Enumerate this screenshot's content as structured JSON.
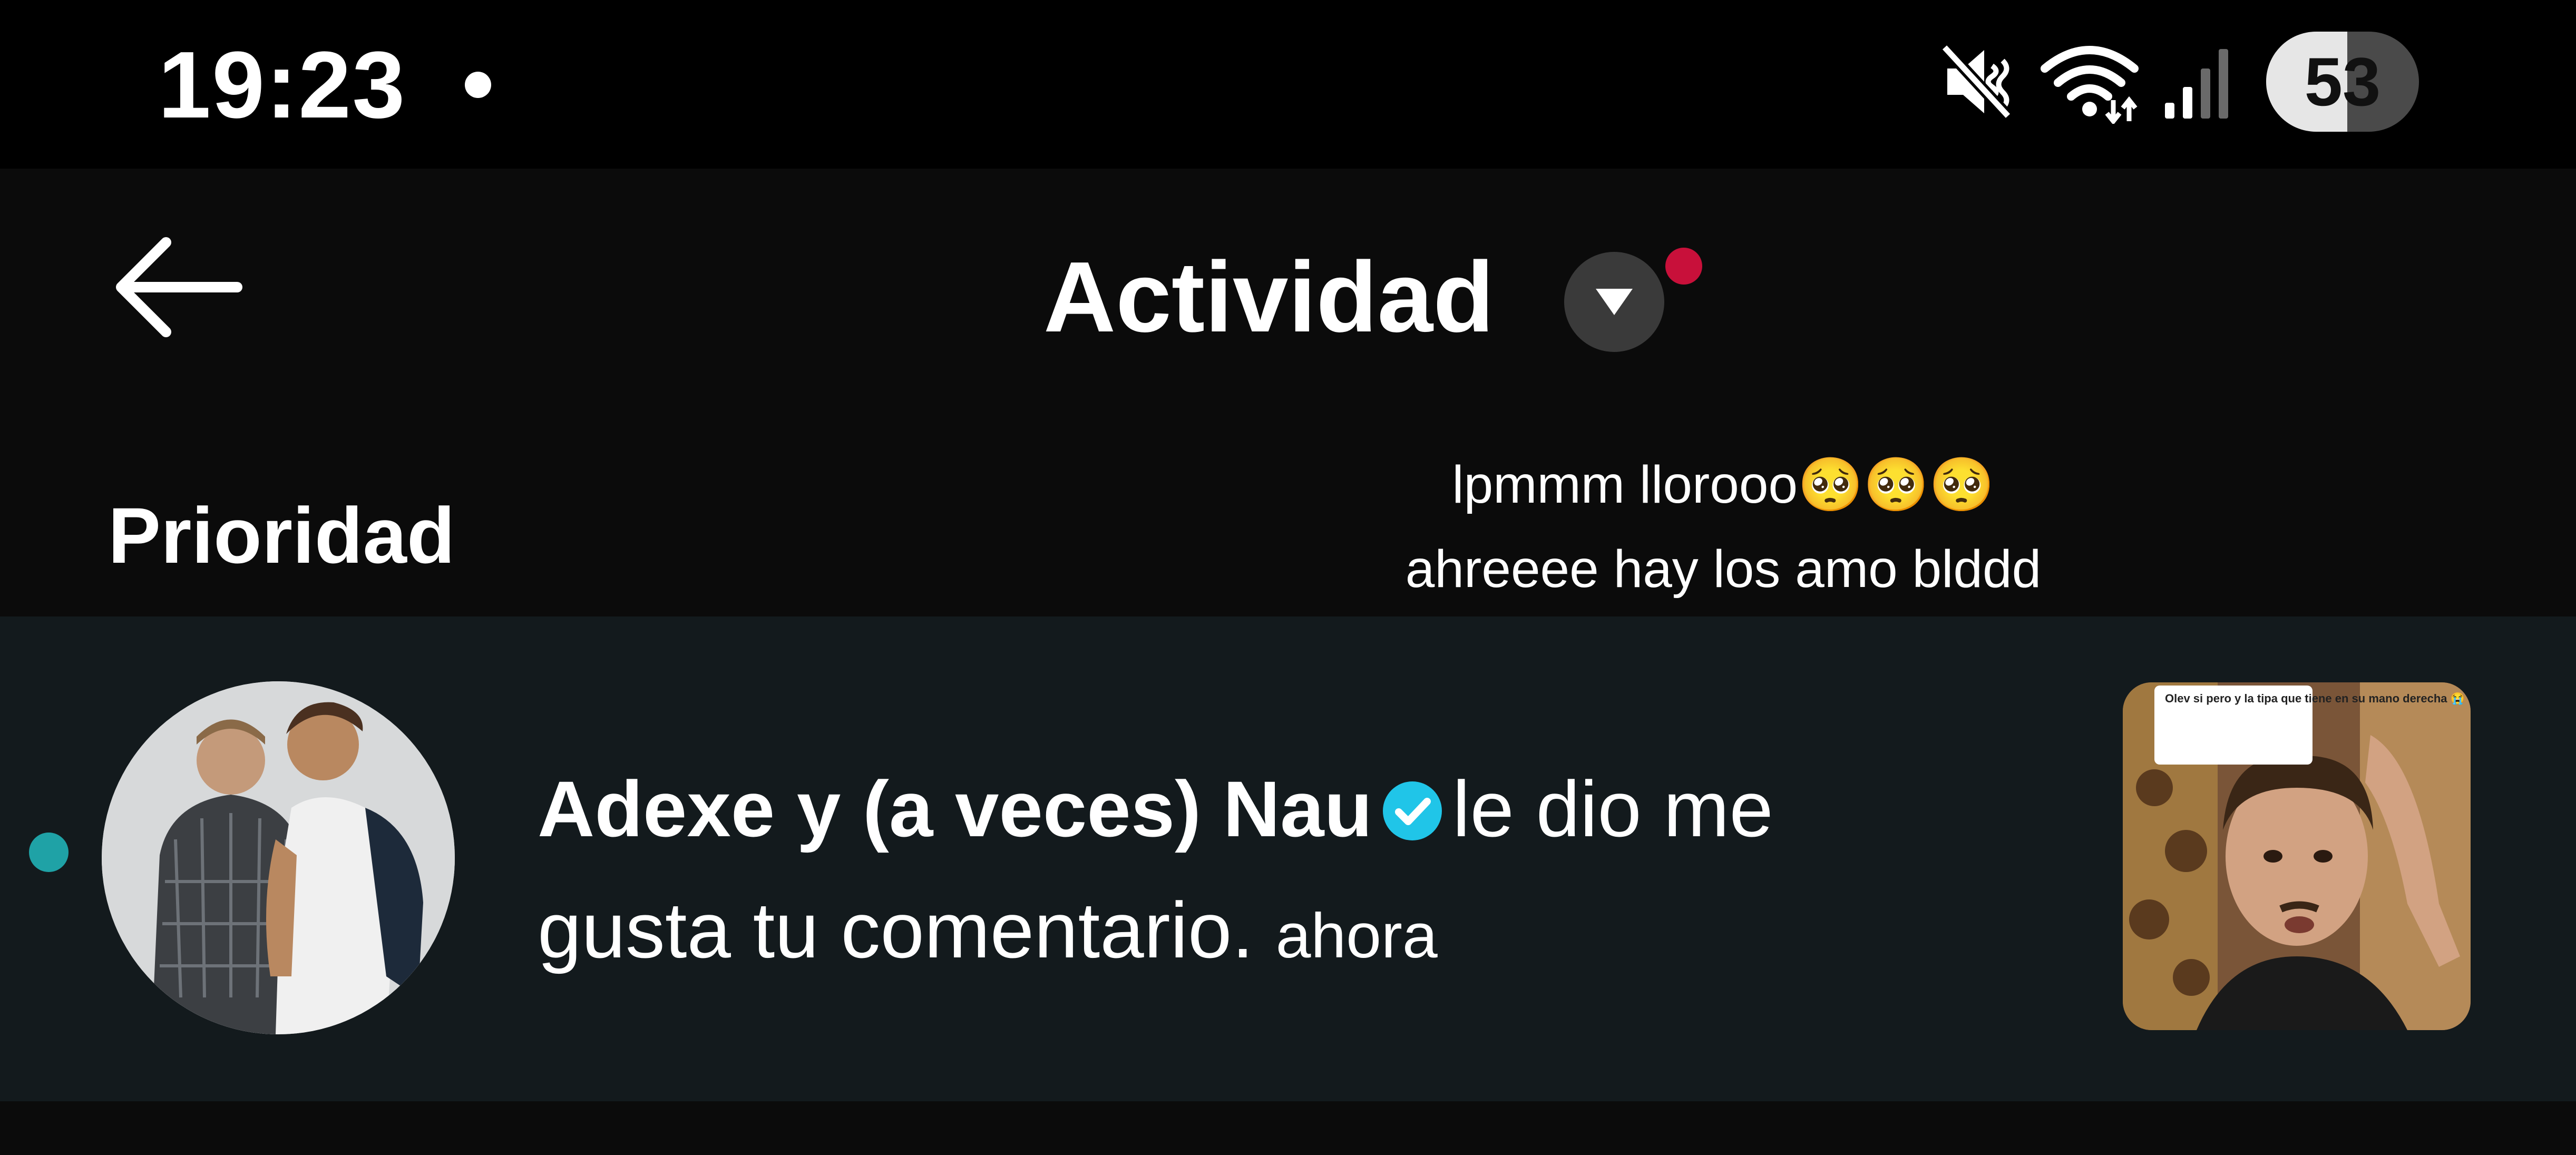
{
  "status_bar": {
    "time": "19:23",
    "battery_level": "53",
    "icons": [
      "mute-icon",
      "wifi-icon",
      "signal-icon"
    ]
  },
  "header": {
    "title": "Actividad",
    "icons": [
      "back-arrow-icon",
      "chevron-down-icon"
    ],
    "notification_dot_color": "#c8103a"
  },
  "section": {
    "label": "Prioridad"
  },
  "comment_overlay": {
    "line1": "lpmmm llorooo🥺🥺🥺",
    "line2": "ahreeee hay los amo blddd"
  },
  "notification": {
    "account_name": "Adexe y (a veces) Nau",
    "action_text": "le dio me gusta tu comentario.",
    "time": "ahora",
    "unread_dot_color": "#1fa2a6",
    "verified_color": "#20c5e8",
    "thumbnail_caption": "Olev si pero y la tipa que tiene en su mano derecha 😭"
  },
  "colors": {
    "background": "#0b0b0b",
    "row_background": "#131a1d",
    "text": "#ffffff"
  }
}
